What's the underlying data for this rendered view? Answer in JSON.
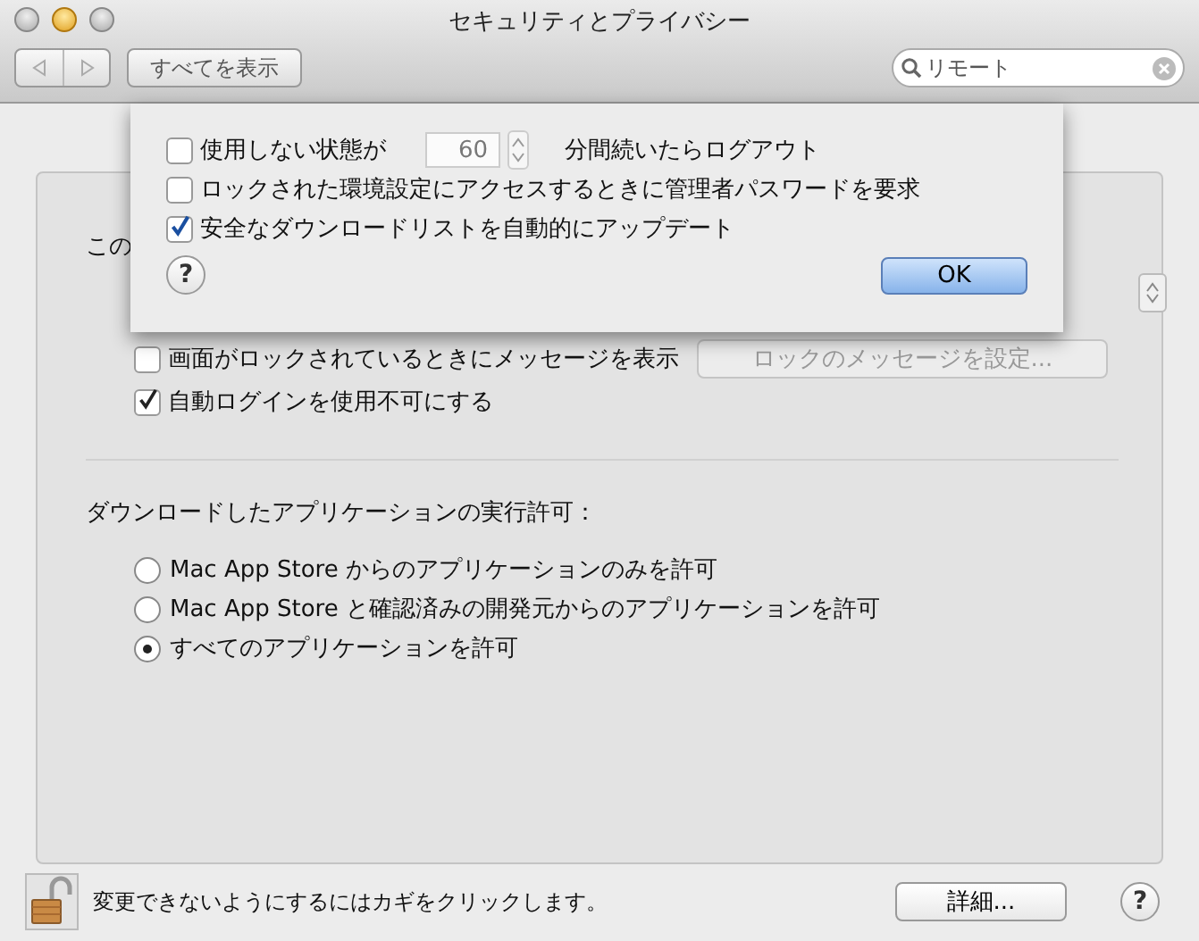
{
  "window": {
    "title": "セキュリティとプライバシー",
    "show_all": "すべてを表示",
    "search": {
      "value": "リモート"
    }
  },
  "panel": {
    "intro_fragment": "この",
    "settings": [
      {
        "label": "画面がロックされているときにメッセージを表示",
        "checked": false,
        "button": "ロックのメッセージを設定...",
        "button_disabled": true
      },
      {
        "label": "自動ログインを使用不可にする",
        "checked": true
      }
    ],
    "download": {
      "heading": "ダウンロードしたアプリケーションの実行許可：",
      "options": [
        {
          "label": "Mac App Store からのアプリケーションのみを許可",
          "selected": false
        },
        {
          "label": "Mac App Store と確認済みの開発元からのアプリケーションを許可",
          "selected": false
        },
        {
          "label": "すべてのアプリケーションを許可",
          "selected": true
        }
      ]
    }
  },
  "sheet": {
    "rows": [
      {
        "kind": "timeout",
        "checked": false,
        "label": "使用しない状態が",
        "value": "60",
        "after": "分間続いたらログアウト"
      },
      {
        "kind": "checkbox",
        "checked": false,
        "label": "ロックされた環境設定にアクセスするときに管理者パスワードを要求"
      },
      {
        "kind": "checkbox",
        "checked": true,
        "label": "安全なダウンロードリストを自動的にアップデート"
      }
    ],
    "ok": "OK",
    "help": "?"
  },
  "footer": {
    "lock_text": "変更できないようにするにはカギをクリックします。",
    "details": "詳細...",
    "help": "?"
  }
}
